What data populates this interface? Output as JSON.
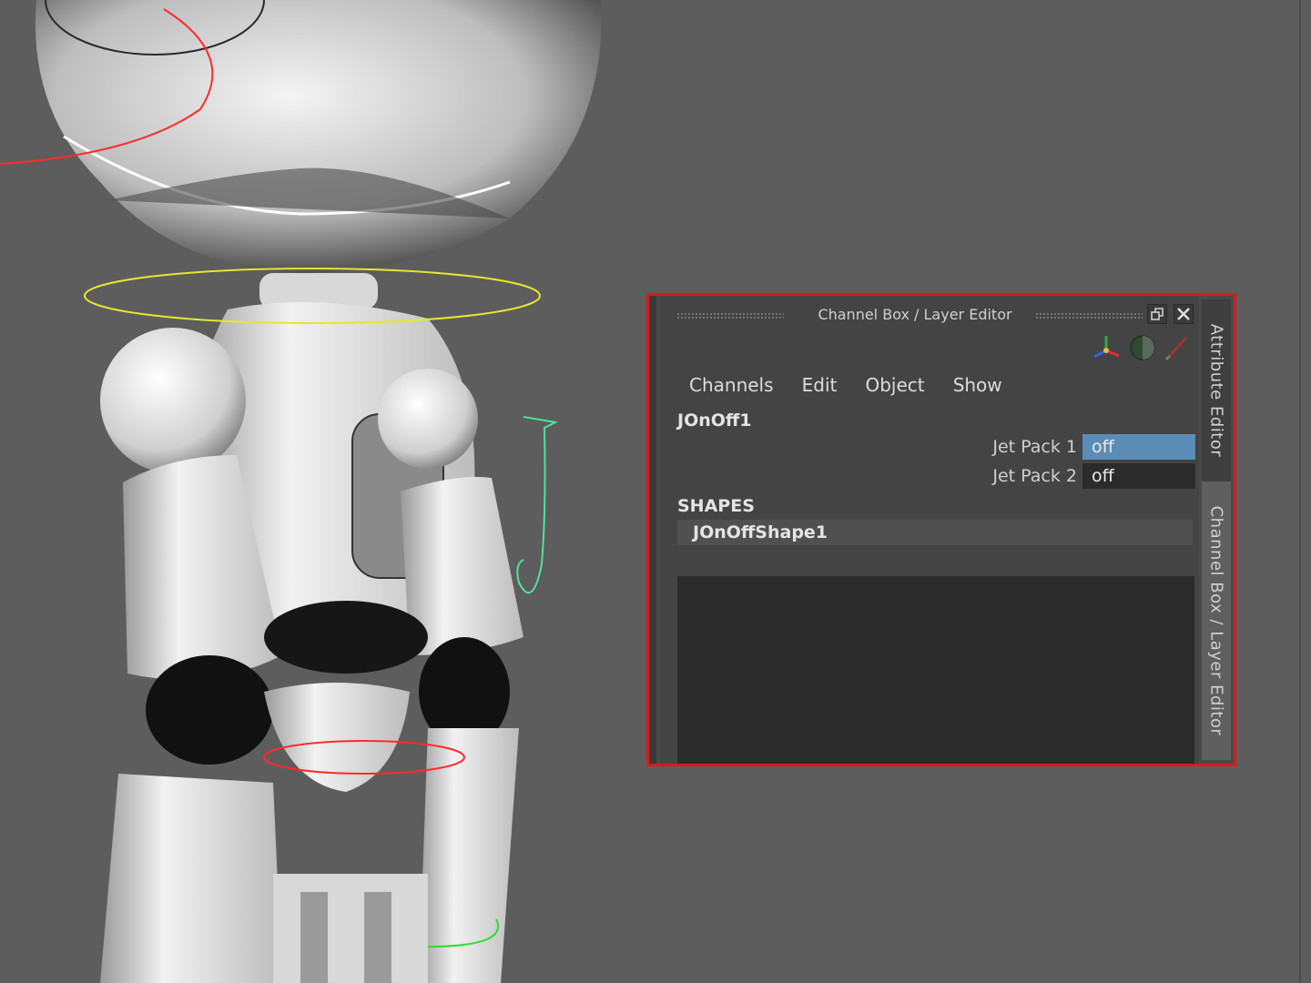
{
  "panel": {
    "title": "Channel Box / Layer Editor",
    "menu": [
      "Channels",
      "Edit",
      "Object",
      "Show"
    ],
    "object_name": "JOnOff1",
    "channels": [
      {
        "label": "Jet Pack 1",
        "value": "off",
        "selected": true
      },
      {
        "label": "Jet Pack 2",
        "value": "off",
        "selected": false
      }
    ],
    "shapes_heading": "SHAPES",
    "shape_name": "JOnOffShape1",
    "side_tabs": [
      "Attribute Editor",
      "Channel Box / Layer Editor"
    ]
  },
  "colors": {
    "highlight": "#d81b1b",
    "selected_value": "#5b8cb8",
    "viewport_bg": "#5d5d5d"
  },
  "icons": [
    "restore-window-icon",
    "close-icon",
    "move-axes-icon",
    "sphere-shading-icon",
    "pen-icon"
  ]
}
